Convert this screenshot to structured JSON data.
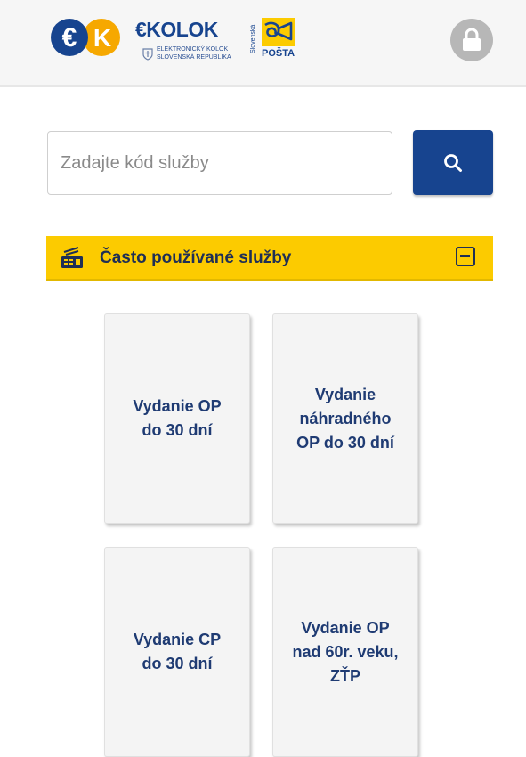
{
  "header": {
    "ek_logo_letters": "EK",
    "ekolok_title": "€KOLOK",
    "ekolok_subtitle_line1": "ELEKTRONICKÝ KOLOK",
    "ekolok_subtitle_line2": "SLOVENSKÁ REPUBLIKA",
    "posta_vertical": "Slovenská",
    "posta_word": "POŠTA",
    "lock_icon": "lock-icon"
  },
  "search": {
    "placeholder": "Zadajte kód služby",
    "value": "",
    "button_icon": "search-icon"
  },
  "section": {
    "title": "Často používané služby",
    "icon": "card-terminal-icon",
    "collapse_icon": "collapse-minus-icon",
    "accent_color": "#fccb00"
  },
  "services": [
    {
      "label": "Vydanie OP do 30 dní"
    },
    {
      "label": "Vydanie náhradného OP do 30 dní"
    },
    {
      "label": "Vydanie CP do 30 dní"
    },
    {
      "label": "Vydanie OP nad 60r. veku, ZŤP"
    }
  ],
  "colors": {
    "primary_blue": "#17448f",
    "ek_orange": "#f6a800",
    "lock_gray": "#b7b7b7"
  }
}
